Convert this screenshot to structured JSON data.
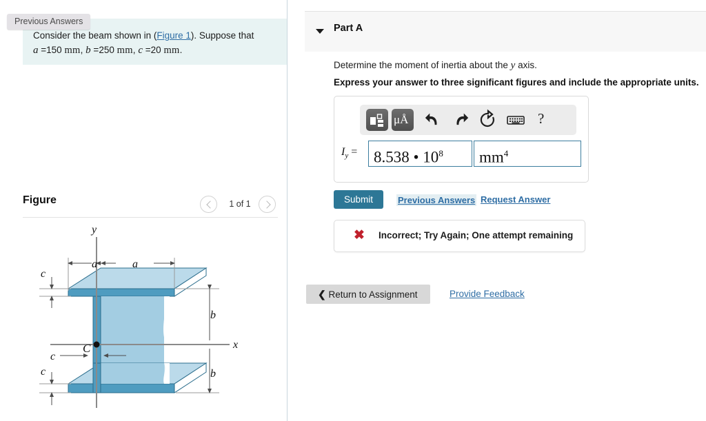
{
  "left": {
    "prev_answers_badge": "Previous Answers",
    "problem_prefix": "Consider the beam shown in (",
    "problem_link": "Figure 1",
    "problem_suffix": "). Suppose that",
    "givens": [
      {
        "var": "a",
        "eq": "=",
        "value": "150",
        "unit": "mm",
        "sep": ","
      },
      {
        "var": "b",
        "eq": "=",
        "value": "250",
        "unit": "mm",
        "sep": ","
      },
      {
        "var": "c",
        "eq": "=",
        "value": "20",
        "unit": "mm",
        "sep": "."
      }
    ],
    "figure_title": "Figure",
    "figure_count": "1 of 1",
    "nav_prev_icon": "chevron-left-icon",
    "nav_next_icon": "chevron-right-icon"
  },
  "figure": {
    "labels": {
      "y_axis": "y",
      "x_axis": "x",
      "centroid": "C",
      "a_left": "a",
      "a_right": "a",
      "c_top": "c",
      "c_bottom": "c",
      "c_web": "c",
      "b_upper": "b",
      "b_lower": "b"
    },
    "colors": {
      "flange_front": "#4f9cc0",
      "flange_top": "#bbdaea",
      "web_face": "#a3cde2",
      "web_edge": "#4f9cc0",
      "outline": "#2b6d8c",
      "dimension_line": "#4d4d4d"
    }
  },
  "right": {
    "part_title": "Part A",
    "caret_icon": "caret-down-icon",
    "question": "Determine the moment of inertia about the y axis.",
    "question_var": "y",
    "instruction": "Express your answer to three significant figures and include the appropriate units.",
    "toolbar": [
      {
        "name": "template-icon",
        "label": ""
      },
      {
        "name": "units-micro-angstrom-icon",
        "label": "μÅ"
      },
      {
        "name": "undo-icon",
        "label": ""
      },
      {
        "name": "redo-icon",
        "label": ""
      },
      {
        "name": "reset-icon",
        "label": ""
      },
      {
        "name": "keyboard-icon",
        "label": ""
      },
      {
        "name": "help-icon",
        "label": "?"
      }
    ],
    "answer": {
      "symbol": "I",
      "subscript": "y",
      "equals": "=",
      "value_mantissa": "8.538 • 10",
      "value_exponent": "8",
      "units_base": "mm",
      "units_exponent": "4"
    },
    "submit_label": "Submit",
    "previous_answers_label": "Previous Answers",
    "request_answer_label": "Request Answer",
    "feedback_icon": "x-mark-icon",
    "feedback_text": "Incorrect; Try Again; One attempt remaining",
    "return_label": "Return to Assignment",
    "return_icon": "chevron-left-icon",
    "provide_feedback_label": "Provide Feedback",
    "accent_color": "#2d7796",
    "error_color": "#c0202c"
  }
}
